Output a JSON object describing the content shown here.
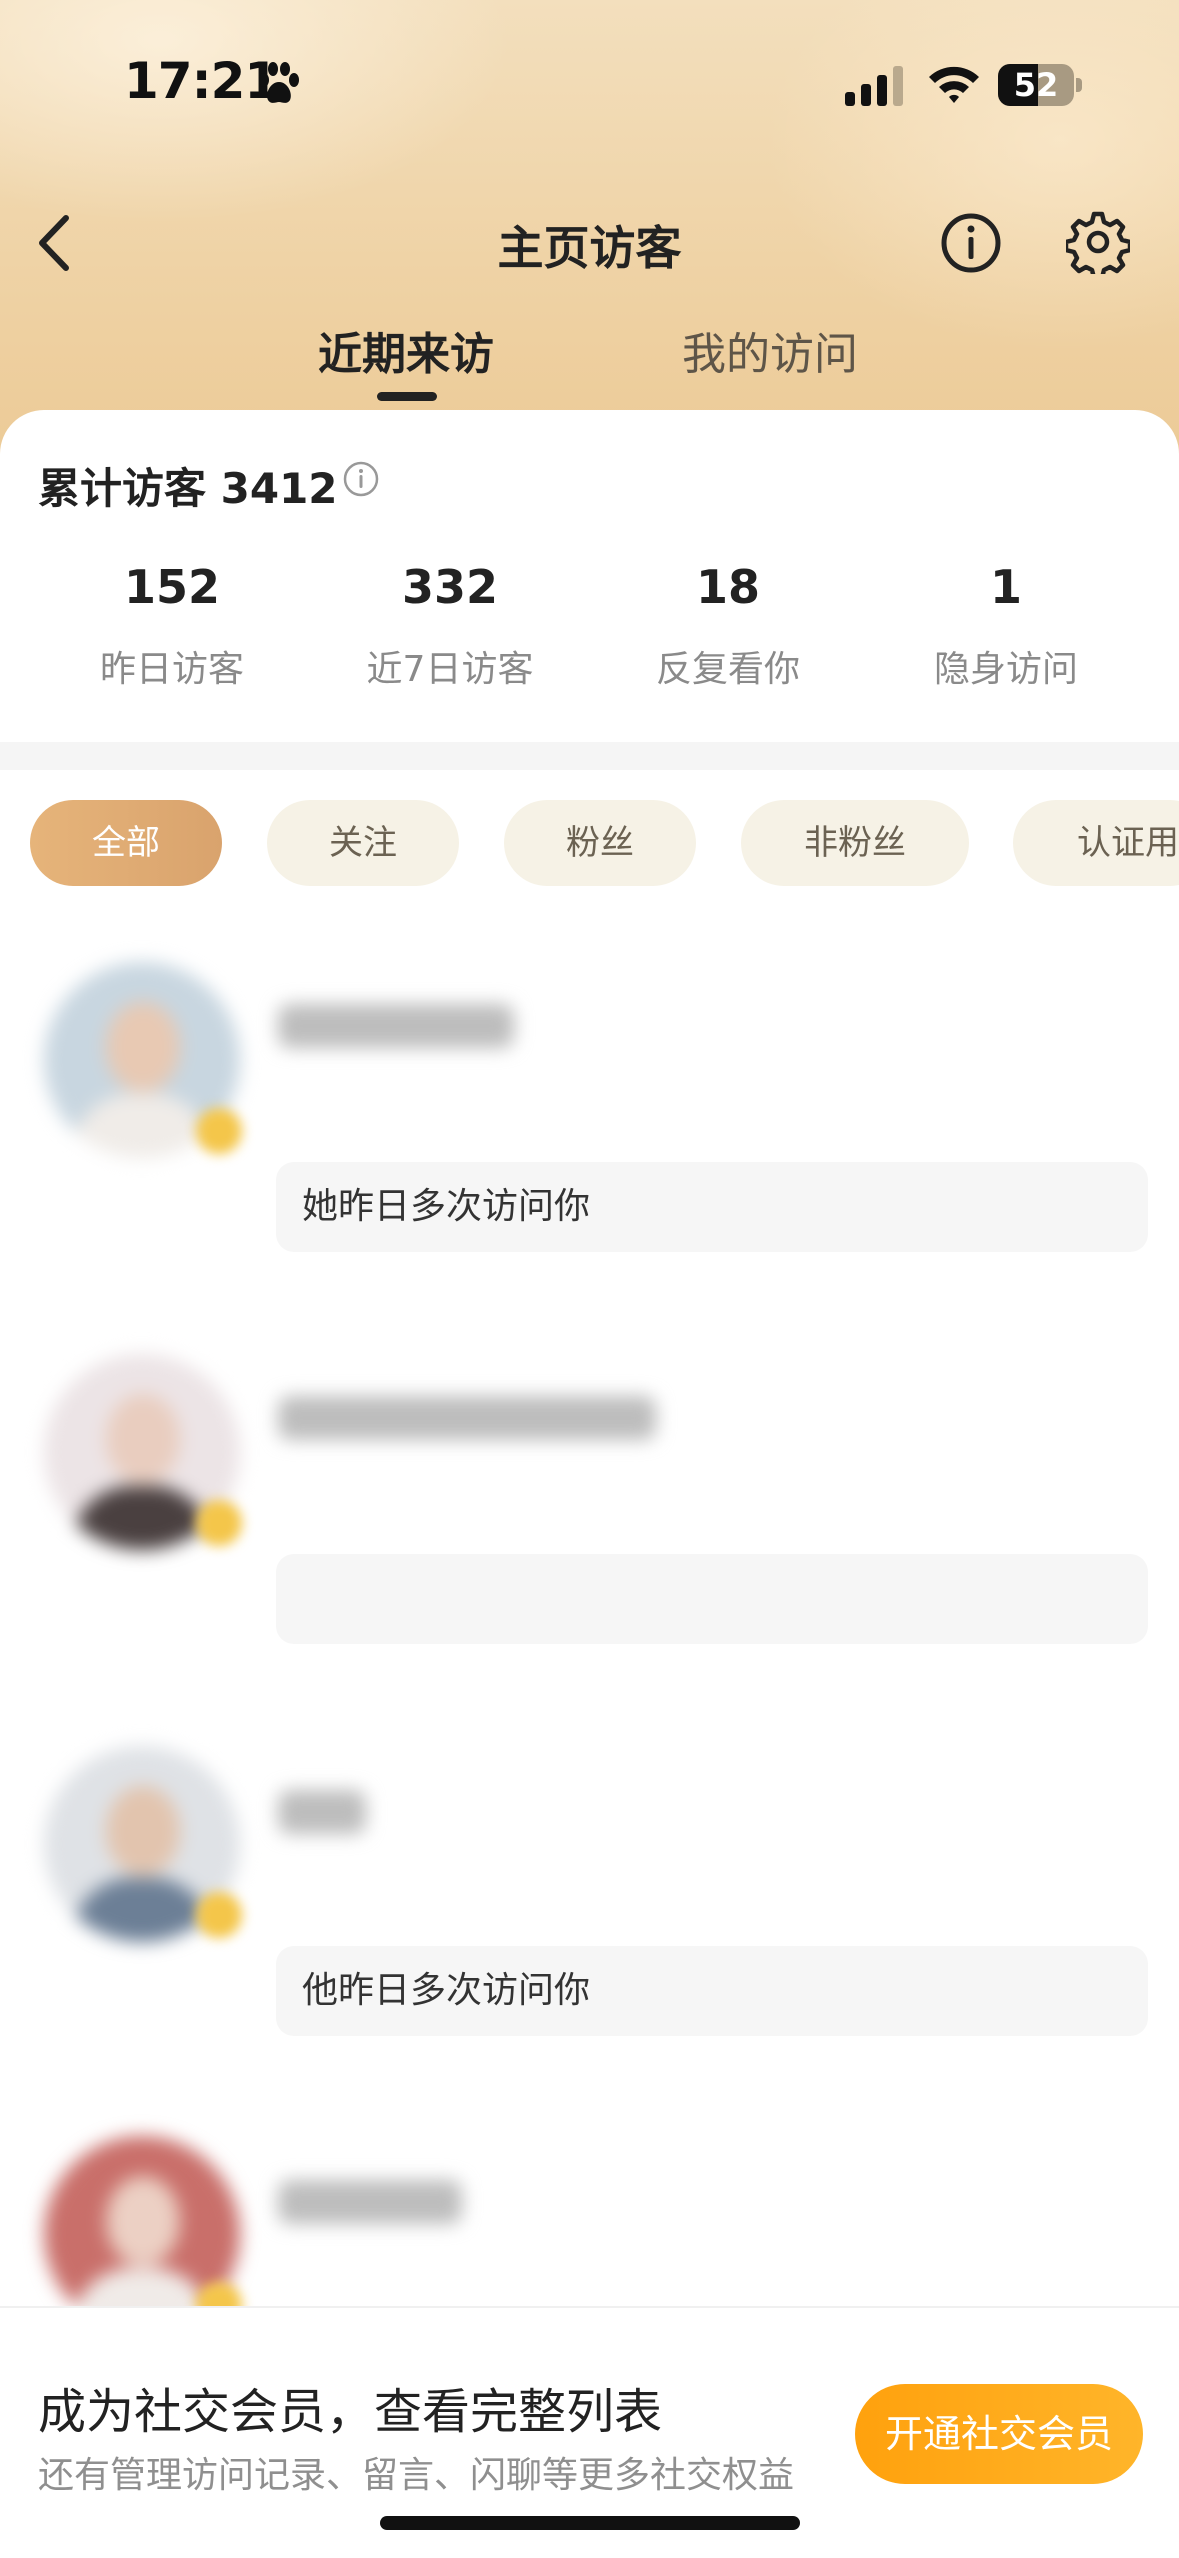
{
  "status_bar": {
    "time": "17:21",
    "battery": "52",
    "battery_level": 0.52
  },
  "header": {
    "title": "主页访客"
  },
  "tabs": [
    {
      "label": "近期来访",
      "active": true
    },
    {
      "label": "我的访问",
      "active": false
    }
  ],
  "summary": {
    "total_label": "累计访客 3412"
  },
  "stats": [
    {
      "value": "152",
      "label": "昨日访客"
    },
    {
      "value": "332",
      "label": "近7日访客"
    },
    {
      "value": "18",
      "label": "反复看你"
    },
    {
      "value": "1",
      "label": "隐身访问"
    }
  ],
  "filters": [
    "全部",
    "关注",
    "粉丝",
    "非粉丝",
    "认证用"
  ],
  "visitors": [
    {
      "note": "她昨日多次访问你"
    },
    {
      "note": ""
    },
    {
      "note": "他昨日多次访问你"
    },
    {
      "note": ""
    }
  ],
  "promo": {
    "title": "成为社交会员，查看完整列表",
    "subtitle": "还有管理访问记录、留言、闪聊等更多社交权益",
    "button": "开通社交会员"
  },
  "colors": {
    "accent": "#d9a36d",
    "button": "#ffa10d",
    "header_bg": "#efd3a6"
  }
}
